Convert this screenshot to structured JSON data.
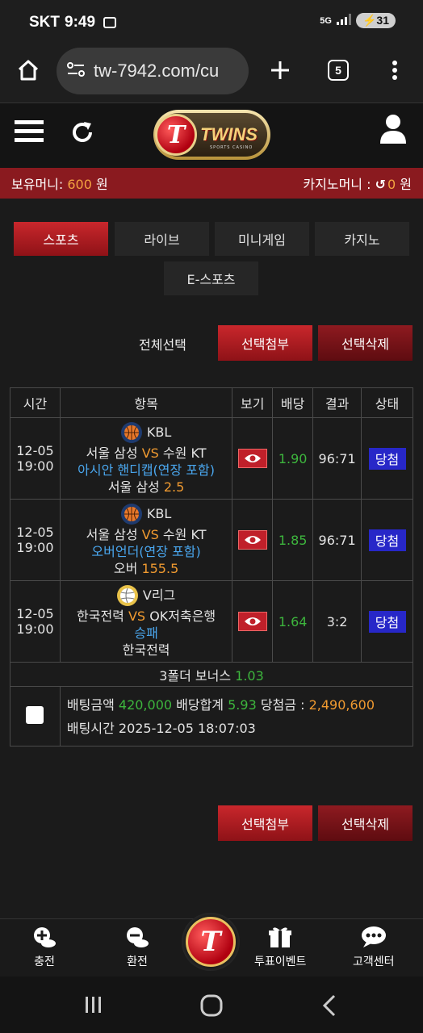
{
  "status_bar": {
    "carrier": "SKT",
    "time": "9:49",
    "network": "5G",
    "battery": "31"
  },
  "browser": {
    "url": "tw-7942.com/cu",
    "tab_count": "5"
  },
  "header": {
    "logo_text": "TWINS",
    "logo_letter": "T",
    "logo_sub": "SPORTS CASINO"
  },
  "money": {
    "label": "보유머니: ",
    "value": "600",
    "unit": " 원",
    "casino_label": "카지노머니 : ",
    "casino_value": "0",
    "casino_unit": " 원"
  },
  "categories": [
    "스포츠",
    "라이브",
    "미니게임",
    "카지노",
    "E-스포츠"
  ],
  "actions": {
    "select_all": "전체선택",
    "attach": "선택첨부",
    "delete": "선택삭제"
  },
  "table": {
    "headers": [
      "시간",
      "항목",
      "보기",
      "배당",
      "결과",
      "상태"
    ],
    "rows": [
      {
        "date": "12-05",
        "time": "19:00",
        "league": "KBL",
        "home": "서울 삼성",
        "vs": "VS",
        "away": "수원 KT",
        "market": "아시안 핸디캡(연장 포함)",
        "pick": "서울 삼성",
        "pick_value": "2.5",
        "odds": "1.90",
        "result": "96:71",
        "status": "당첨"
      },
      {
        "date": "12-05",
        "time": "19:00",
        "league": "KBL",
        "home": "서울 삼성",
        "vs": "VS",
        "away": "수원 KT",
        "market": "오버언더(연장 포함)",
        "pick": "오버",
        "pick_value": "155.5",
        "odds": "1.85",
        "result": "96:71",
        "status": "당첨"
      },
      {
        "date": "12-05",
        "time": "19:00",
        "league": "V리그",
        "home": "한국전력",
        "vs": "VS",
        "away": "OK저축은행",
        "market": "승패",
        "pick": "한국전력",
        "pick_value": "",
        "odds": "1.64",
        "result": "3:2",
        "status": "당첨"
      }
    ],
    "bonus_label": "3폴더 보너스 ",
    "bonus_value": "1.03",
    "bet": {
      "amount_label": "배팅금액 ",
      "amount": "420,000",
      "total_label": " 배당합계 ",
      "total": "5.93",
      "win_label": " 당첨금 : ",
      "win": "2,490,600",
      "time_label": "배팅시간 ",
      "time": "2025-12-05 18:07:03"
    }
  },
  "bottom_nav": [
    "충전",
    "환전",
    "투표이벤트",
    "고객센터"
  ],
  "colors": {
    "accent_red": "#c9272c",
    "win_blue": "#2727c8",
    "odds_green": "#3db63d",
    "vs_orange": "#f09a30",
    "market_blue": "#4aa7ef"
  }
}
